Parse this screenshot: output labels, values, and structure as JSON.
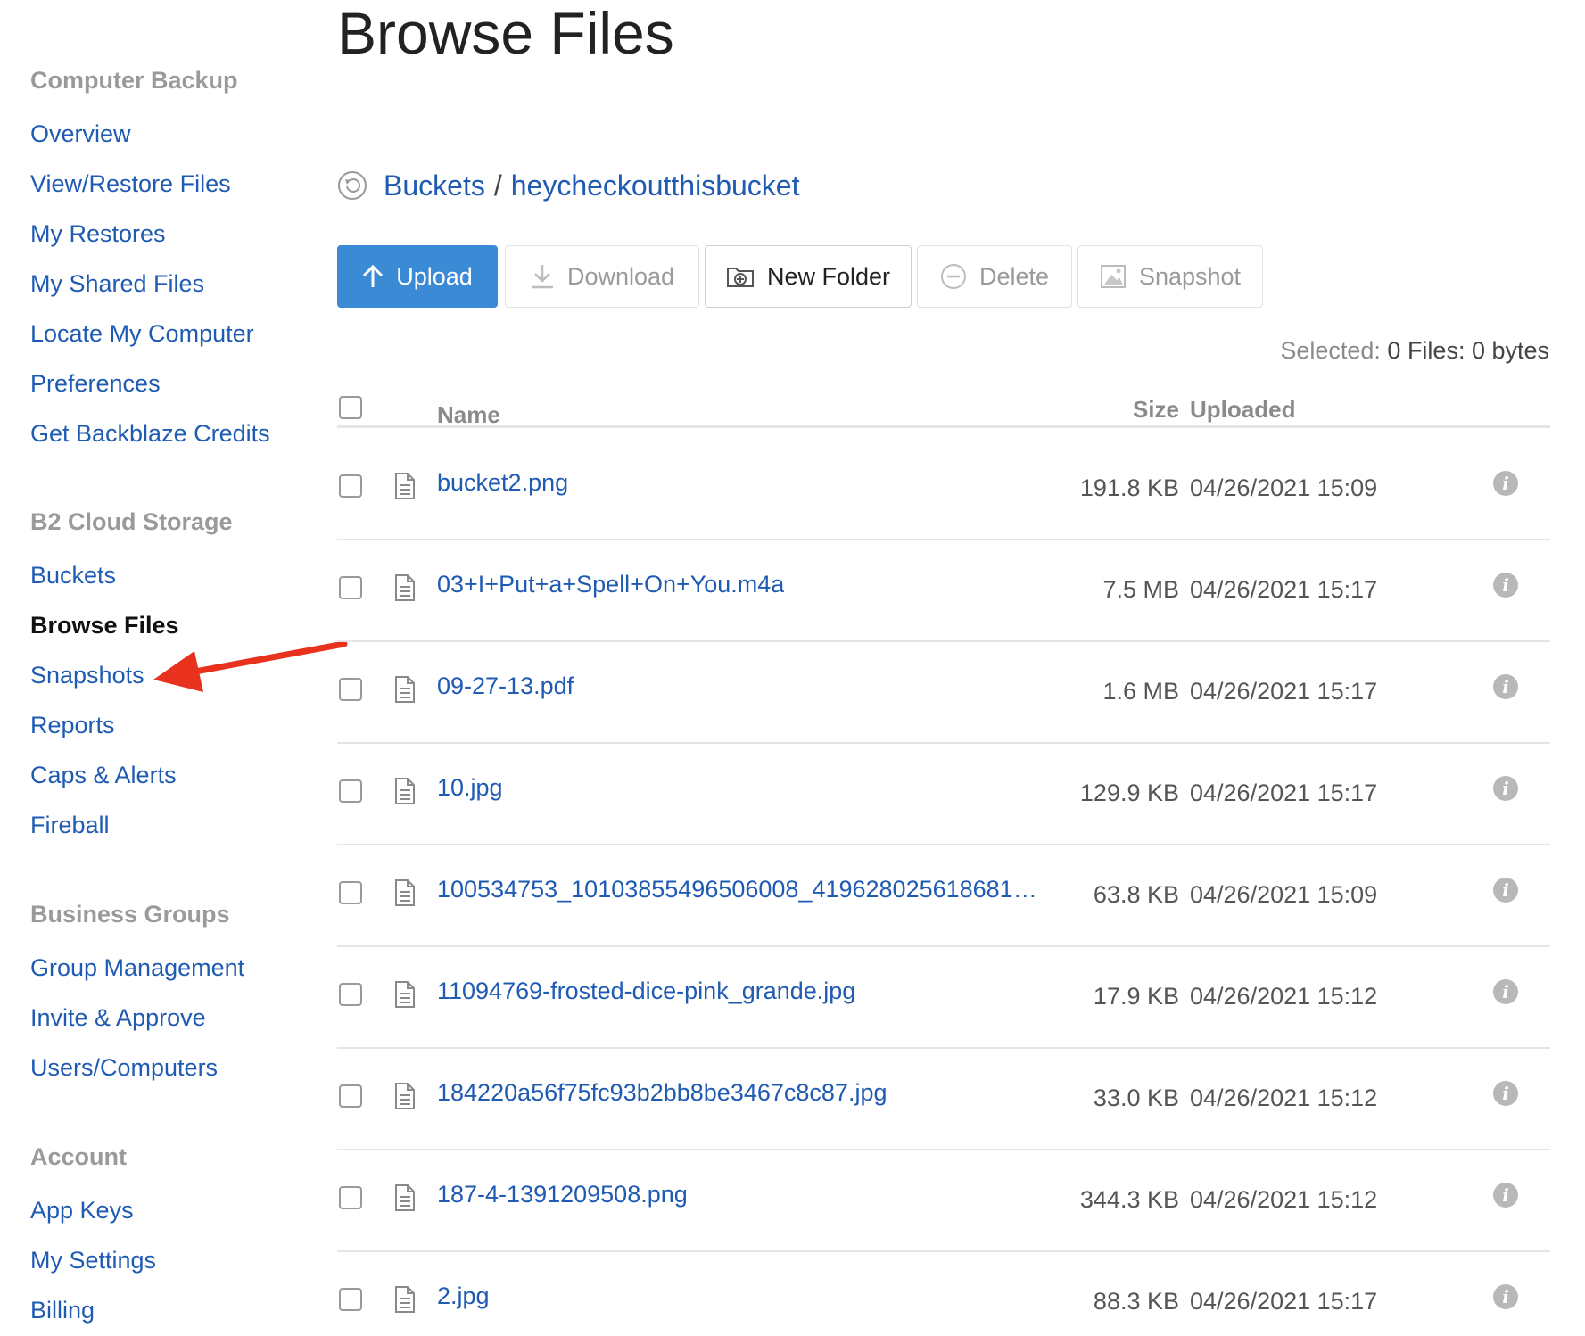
{
  "page": {
    "title": "Browse Files"
  },
  "sidebar": {
    "sections": [
      {
        "heading": "Computer Backup",
        "items": [
          "Overview",
          "View/Restore Files",
          "My Restores",
          "My Shared Files",
          "Locate My Computer",
          "Preferences",
          "Get Backblaze Credits"
        ]
      },
      {
        "heading": "B2 Cloud Storage",
        "items": [
          "Buckets",
          "Browse Files",
          "Snapshots",
          "Reports",
          "Caps & Alerts",
          "Fireball"
        ]
      },
      {
        "heading": "Business Groups",
        "items": [
          "Group Management",
          "Invite & Approve",
          "Users/Computers"
        ]
      },
      {
        "heading": "Account",
        "items": [
          "App Keys",
          "My Settings",
          "Billing"
        ]
      }
    ],
    "active_item": "Browse Files"
  },
  "breadcrumb": {
    "root": "Buckets",
    "separator": "/",
    "bucket": "heycheckoutthisbucket"
  },
  "toolbar": {
    "upload": "Upload",
    "download": "Download",
    "new_folder": "New Folder",
    "delete": "Delete",
    "snapshot": "Snapshot"
  },
  "selection": {
    "label": "Selected:",
    "value": "0 Files: 0 bytes"
  },
  "table": {
    "columns": {
      "name": "Name",
      "size": "Size",
      "uploaded": "Uploaded"
    },
    "rows": [
      {
        "name": "bucket2.png",
        "size": "191.8 KB",
        "uploaded": "04/26/2021 15:09"
      },
      {
        "name": "03+I+Put+a+Spell+On+You.m4a",
        "size": "7.5 MB",
        "uploaded": "04/26/2021 15:17"
      },
      {
        "name": "09-27-13.pdf",
        "size": "1.6 MB",
        "uploaded": "04/26/2021 15:17"
      },
      {
        "name": "10.jpg",
        "size": "129.9 KB",
        "uploaded": "04/26/2021 15:17"
      },
      {
        "name": "100534753_10103855496506008_419628025618681…",
        "size": "63.8 KB",
        "uploaded": "04/26/2021 15:09"
      },
      {
        "name": "11094769-frosted-dice-pink_grande.jpg",
        "size": "17.9 KB",
        "uploaded": "04/26/2021 15:12"
      },
      {
        "name": "184220a56f75fc93b2bb8be3467c8c87.jpg",
        "size": "33.0 KB",
        "uploaded": "04/26/2021 15:12"
      },
      {
        "name": "187-4-1391209508.png",
        "size": "344.3 KB",
        "uploaded": "04/26/2021 15:12"
      },
      {
        "name": "2.jpg",
        "size": "88.3 KB",
        "uploaded": "04/26/2021 15:17"
      }
    ]
  },
  "icons": {
    "back": "history-back-icon",
    "upload": "arrow-up-icon",
    "download": "download-icon",
    "new_folder": "new-folder-icon",
    "delete": "minus-circle-icon",
    "snapshot": "image-icon",
    "file": "file-icon",
    "info": "info-icon",
    "annotation": "red-arrow-icon"
  },
  "colors": {
    "link": "#1f5bb3",
    "primary_button": "#3a8ad6",
    "annotation_arrow": "#e8321d"
  }
}
